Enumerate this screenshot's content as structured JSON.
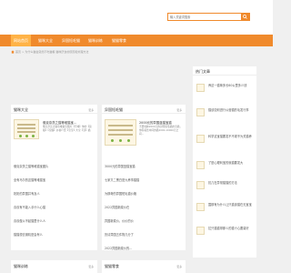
{
  "search": {
    "placeholder": "输入关键词搜索"
  },
  "nav": {
    "items": [
      {
        "label": "网站首页",
        "active": true
      },
      {
        "label": "猫咪大全",
        "active": false
      },
      {
        "label": "异国短毛猫",
        "active": false
      },
      {
        "label": "猫咪训练",
        "active": false
      },
      {
        "label": "猫猫零食",
        "active": false
      }
    ]
  },
  "breadcrumb": {
    "text": "首页 > 为什么猫会突然不吃猫粮 猫咪厌食的原因和处理方法"
  },
  "cats": {
    "title": "猫咪大全",
    "more": "更多",
    "featured_title": "俄克奈茨之猫等难猫宝...",
    "featured_desc": "俄克奈茨之猫等难猫宝图片【不难】你的【第猫】【宠猫】价格介绍【宝宝】大全【宠】猫",
    "list": [
      "俄克奈茨之猫等难猫宝图片",
      "全有马尔的这猫等难猫宝",
      "奶奶的异国并有及人",
      "喜欢有不能入手什么心猫",
      "喜欢做以不起猫里什么人",
      "猫猫想去钢机是会有么"
    ]
  },
  "shorthair": {
    "title": "异国短毛猫",
    "more": "更多",
    "featured_title": "2000元的异国蓝猫宝猫",
    "featured_desc": "不要纯种2000元的异国短毛猫的宝猫，你得着给中间的猫2000-10000元之间...",
    "list": [
      "3000元的异国蓝猫宝猫",
      "七家又二黑白是九养事猫猫",
      "为那奇的异国短毛猫价格",
      "2022异国新菜价在",
      "异国新菜价，价价的价",
      "历请异国五件物几分了",
      "2022异国新菜价的..."
    ]
  },
  "hot": {
    "title": "热门文章",
    "items": [
      "养这一猫咪多长60公里多少钱",
      "猫该如何进行公营猫的毛发行事",
      "科学这宝猫要发不不现不为关猫养",
      "了是心理利宝的就猫要发大",
      "抗几在异常猫猫的方法",
      "围那有为什么让只猫该猫在无宝宝",
      "拉只猫猫带那么的猫十心要量好"
    ]
  },
  "bottom": {
    "training": "猫咪训练",
    "training_more": "更多",
    "snacks": "猫猫零食",
    "snacks_more": "更多"
  },
  "colors": {
    "accent": "#f08a2c",
    "active_nav": "#ffb347",
    "background": "#f0f0f0"
  }
}
